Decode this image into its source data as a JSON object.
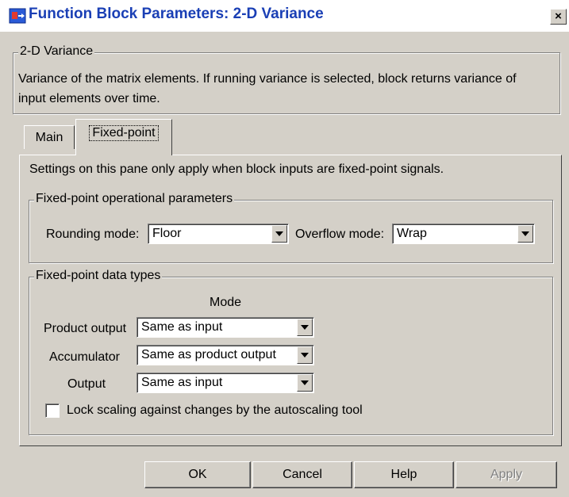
{
  "window": {
    "title": "Function Block Parameters: 2-D Variance",
    "close_glyph": "×",
    "icon": "simulink-block-icon"
  },
  "block": {
    "group_label": "2-D Variance",
    "description": "Variance of the matrix elements. If running variance is selected, block returns variance of input elements over time."
  },
  "tabs": [
    {
      "label": "Main",
      "selected": false
    },
    {
      "label": "Fixed-point",
      "selected": true
    }
  ],
  "pane": {
    "note": "Settings on this pane only apply when block inputs are fixed-point signals."
  },
  "operational": {
    "group_label": "Fixed-point operational parameters",
    "rounding_label": "Rounding mode:",
    "rounding_value": "Floor",
    "overflow_label": "Overflow mode:",
    "overflow_value": "Wrap"
  },
  "datatypes": {
    "group_label": "Fixed-point data types",
    "mode_header": "Mode",
    "rows": [
      {
        "label": "Product output",
        "value": "Same as input"
      },
      {
        "label": "Accumulator",
        "value": "Same as product output"
      },
      {
        "label": "Output",
        "value": "Same as input"
      }
    ],
    "lock_label": "Lock scaling against changes by the autoscaling tool",
    "lock_checked": false
  },
  "buttons": {
    "ok": "OK",
    "cancel": "Cancel",
    "help": "Help",
    "apply": "Apply"
  }
}
